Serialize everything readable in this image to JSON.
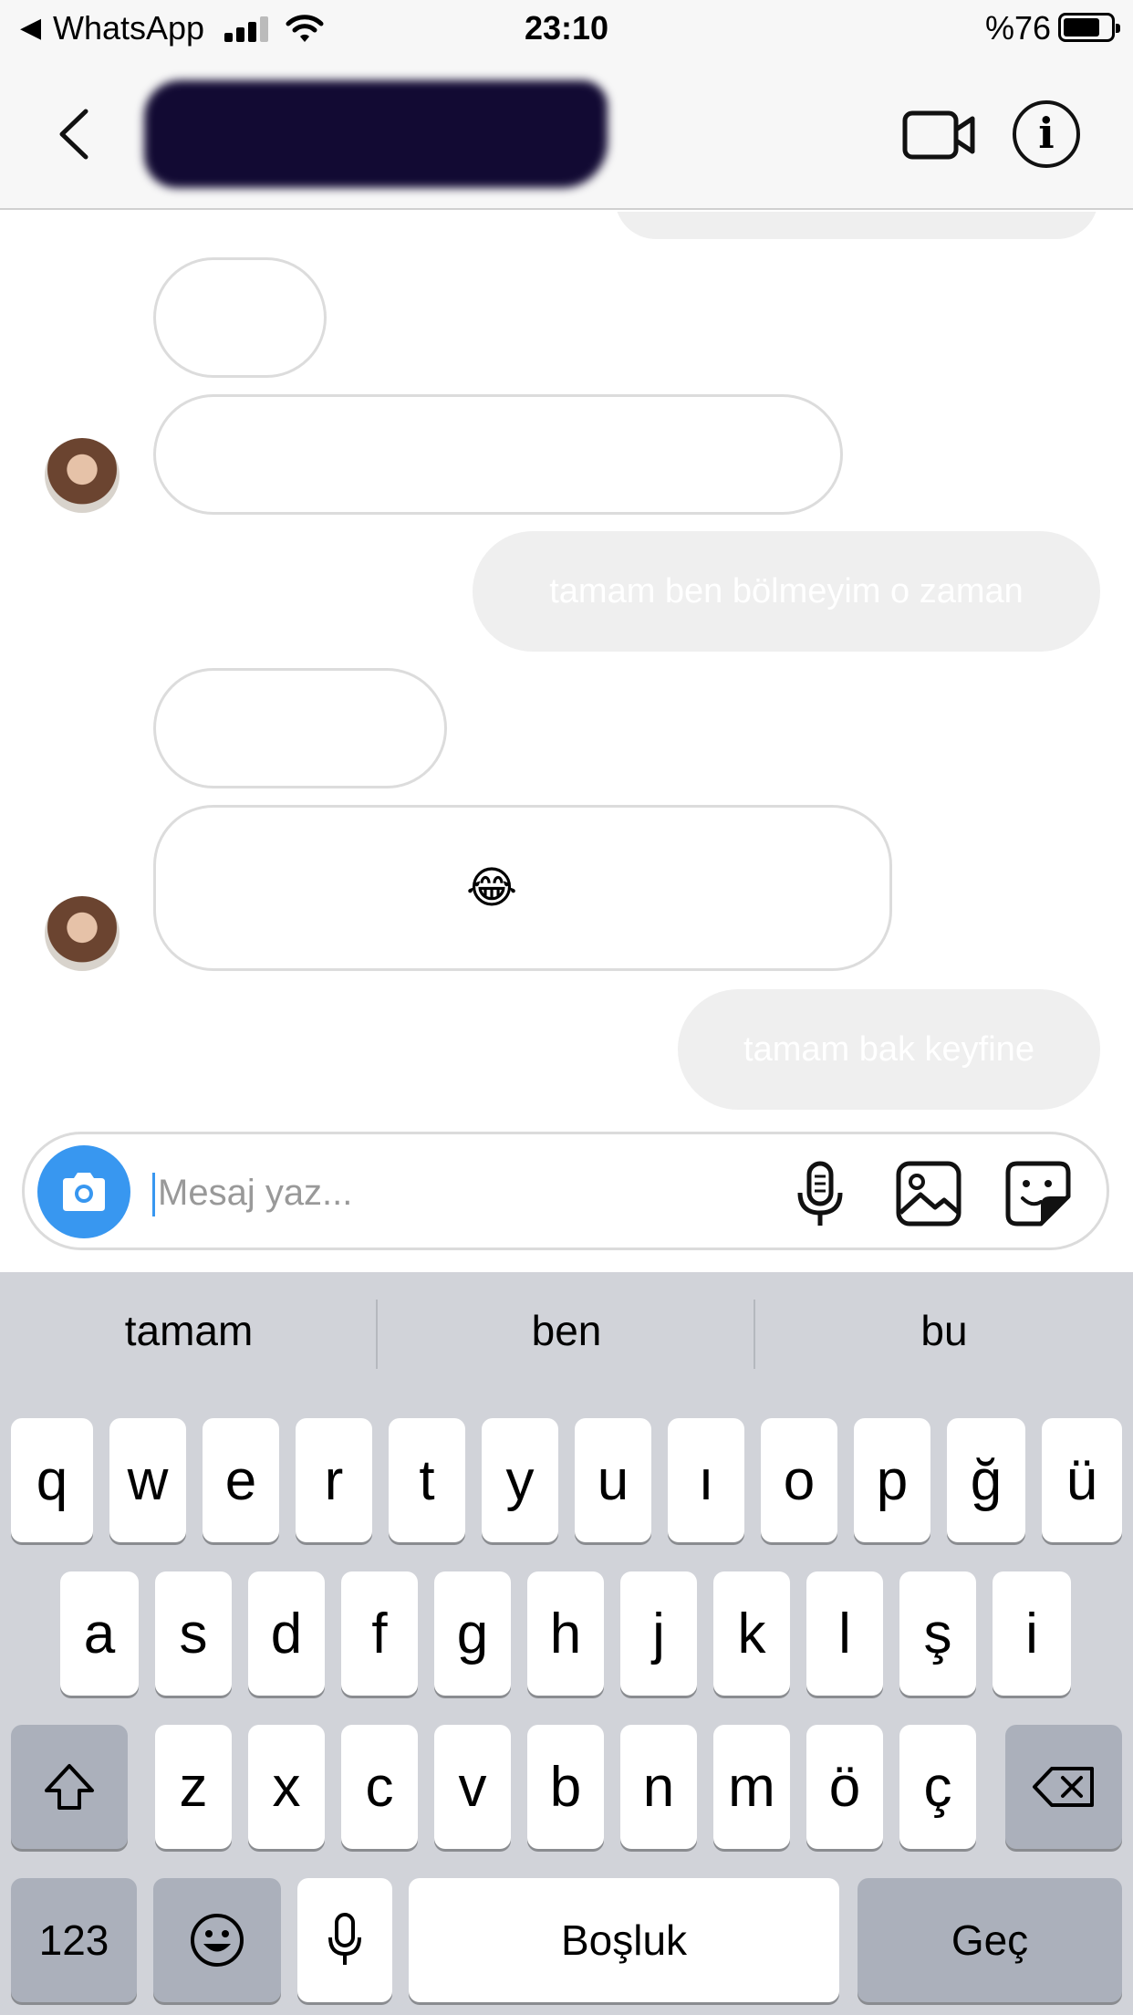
{
  "status_bar": {
    "back_app": "WhatsApp",
    "time": "23:10",
    "battery": "%76",
    "battery_level": 0.76
  },
  "header": {
    "contact_name_redacted": true
  },
  "messages": [
    {
      "direction": "outgoing",
      "text": ""
    },
    {
      "direction": "incoming",
      "text": ""
    },
    {
      "direction": "incoming",
      "text": ""
    },
    {
      "direction": "outgoing",
      "text": "tamam ben bölmeyim o zaman"
    },
    {
      "direction": "incoming",
      "text": ""
    },
    {
      "direction": "incoming",
      "text": "😂"
    },
    {
      "direction": "outgoing",
      "text": "tamam bak keyfine"
    }
  ],
  "composer": {
    "placeholder": "Mesaj yaz...",
    "value": ""
  },
  "keyboard": {
    "suggestions": [
      "tamam",
      "ben",
      "bu"
    ],
    "row1": [
      "q",
      "w",
      "e",
      "r",
      "t",
      "y",
      "u",
      "ı",
      "o",
      "p",
      "ğ",
      "ü"
    ],
    "row2": [
      "a",
      "s",
      "d",
      "f",
      "g",
      "h",
      "j",
      "k",
      "l",
      "ş",
      "i"
    ],
    "row3": [
      "z",
      "x",
      "c",
      "v",
      "b",
      "n",
      "m",
      "ö",
      "ç"
    ],
    "numbers_key": "123",
    "space_key": "Boşluk",
    "return_key": "Geç"
  },
  "colors": {
    "accent": "#3897f0",
    "outgoing_bubble": "#efefef",
    "incoming_border": "#dcdcdc",
    "keyboard_bg": "#d1d3d9"
  },
  "icons": [
    "back-arrow-icon",
    "video-call-icon",
    "info-icon",
    "camera-icon",
    "microphone-icon",
    "gallery-icon",
    "sticker-icon",
    "shift-icon",
    "backspace-icon",
    "emoji-icon",
    "dictation-icon"
  ]
}
